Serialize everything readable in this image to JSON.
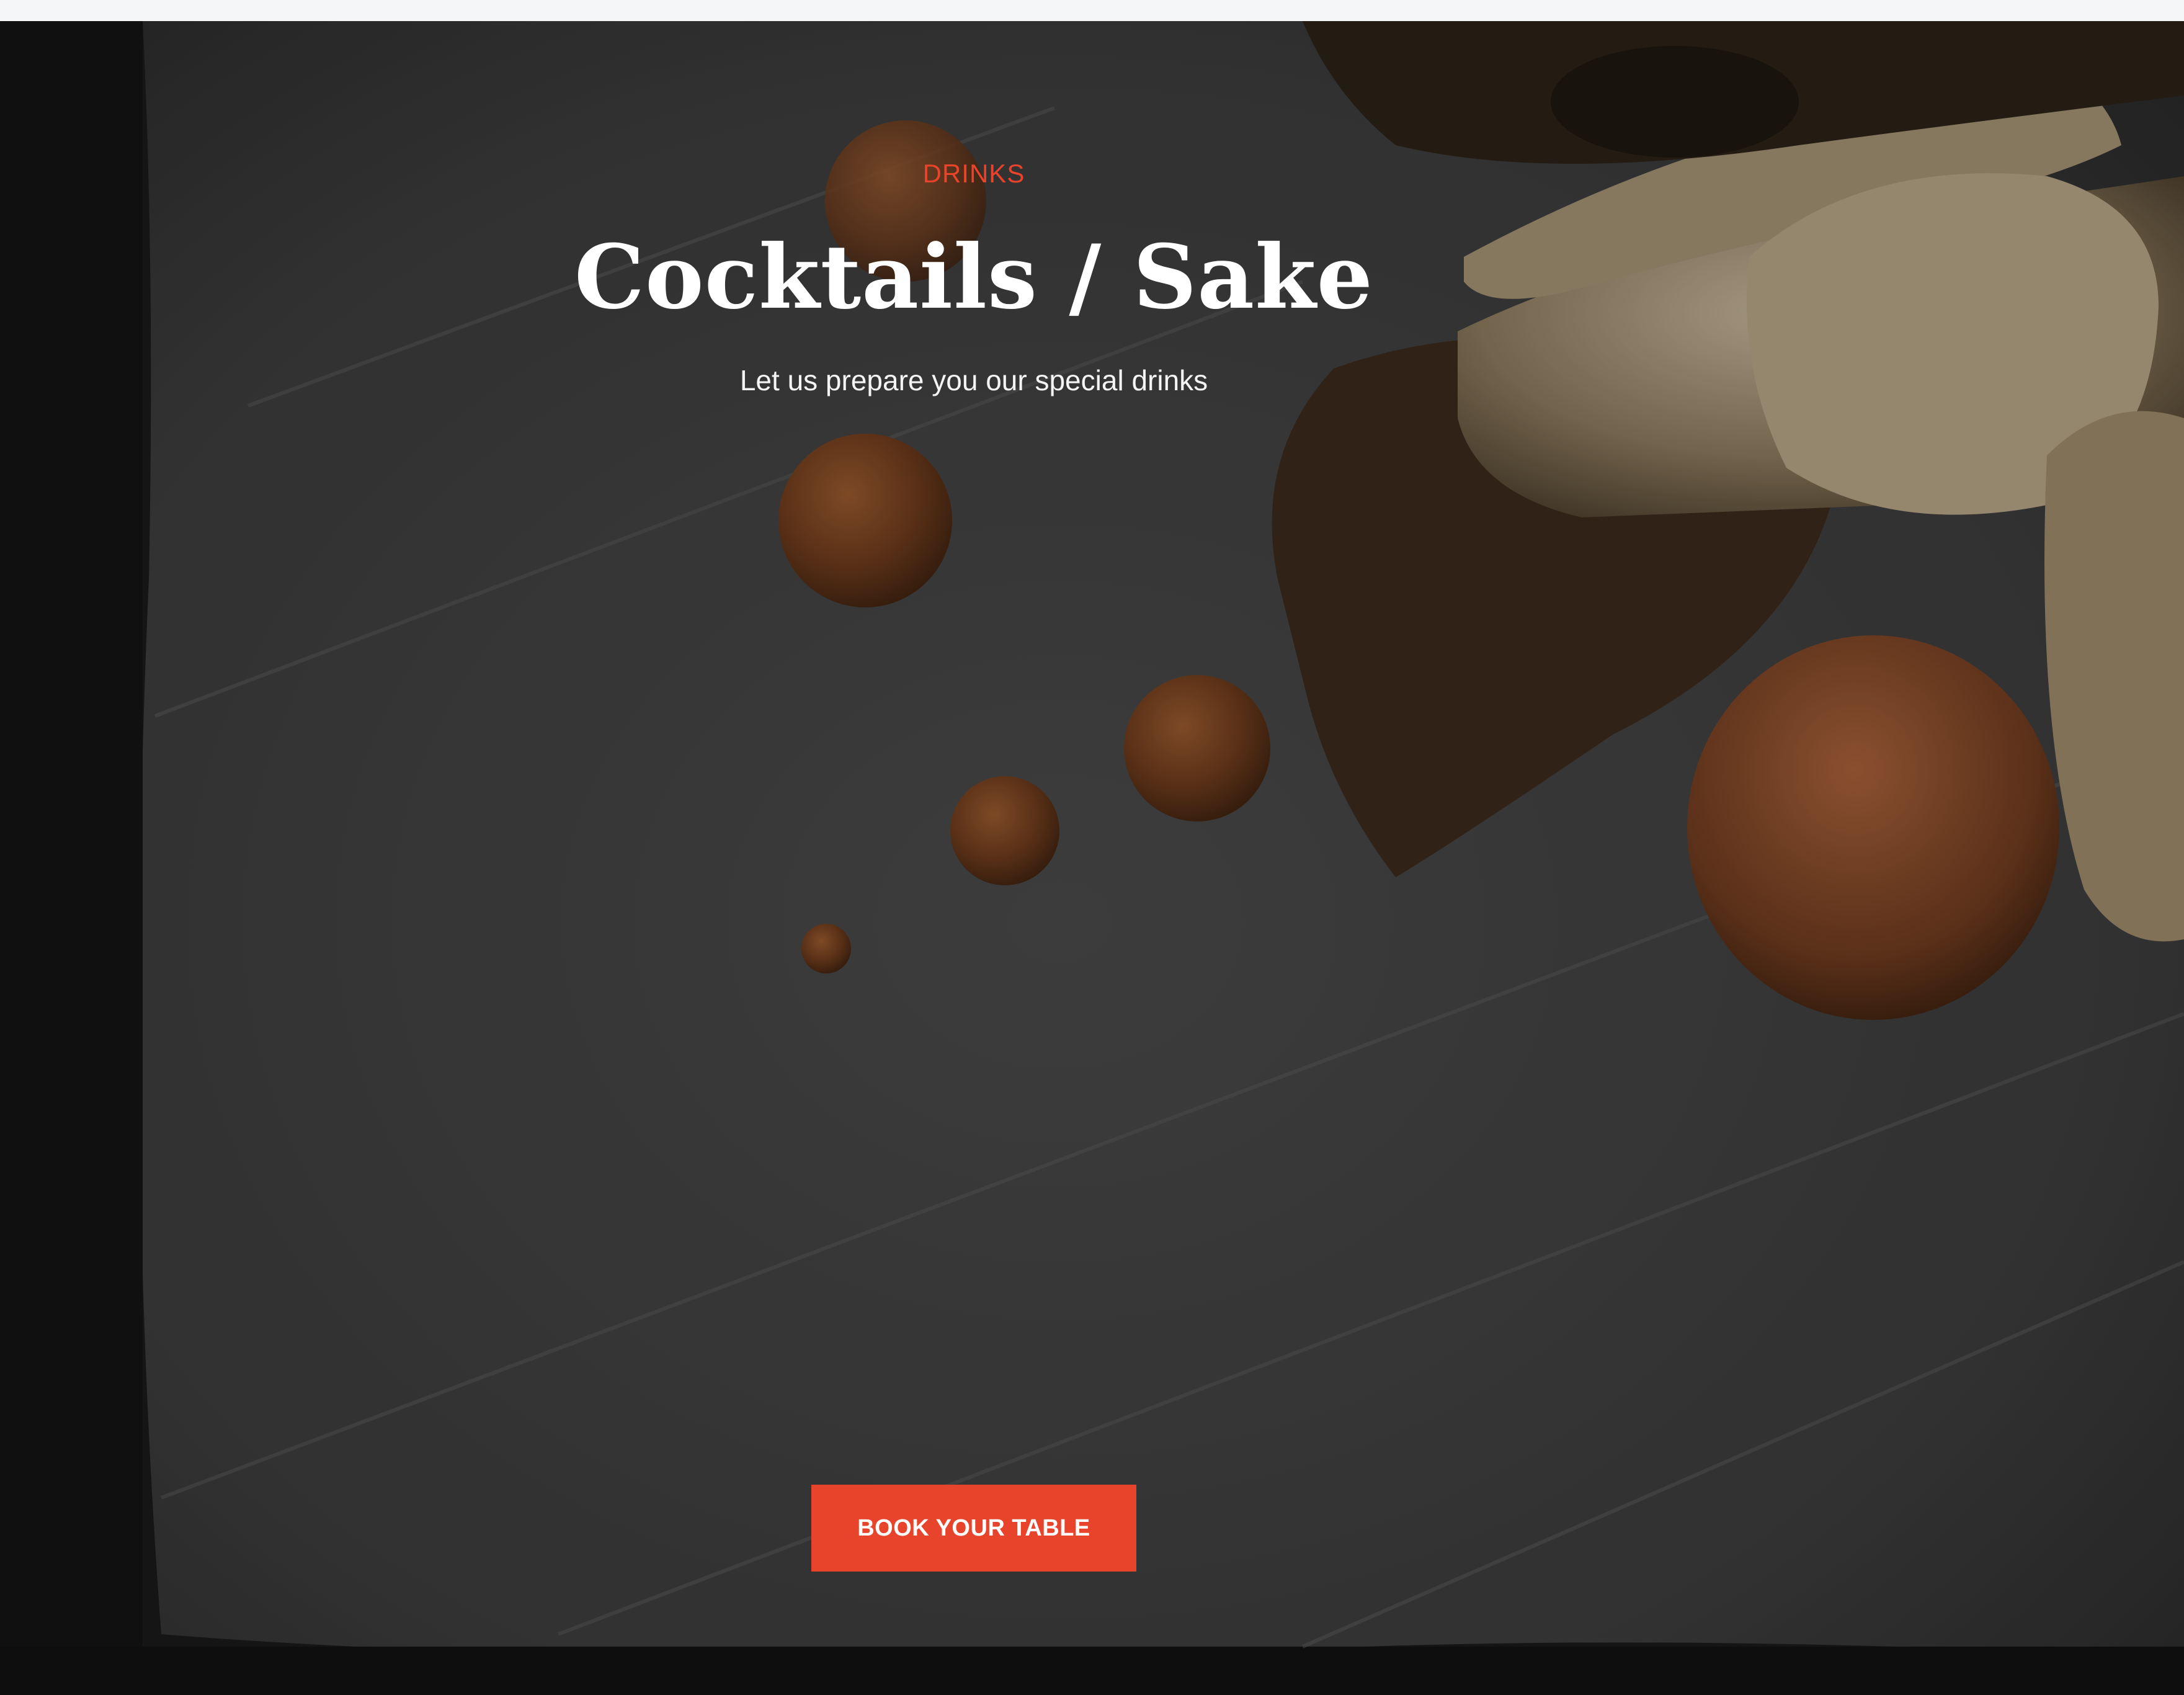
{
  "hero": {
    "eyebrow": "DRINKS",
    "title": "Cocktails / Sake",
    "subtitle": "Let us prepare you our special drinks",
    "cta_label": "BOOK YOUR TABLE"
  },
  "colors": {
    "accent": "#e8432b",
    "heading": "#ffffff",
    "background": "#3a3a3a"
  }
}
